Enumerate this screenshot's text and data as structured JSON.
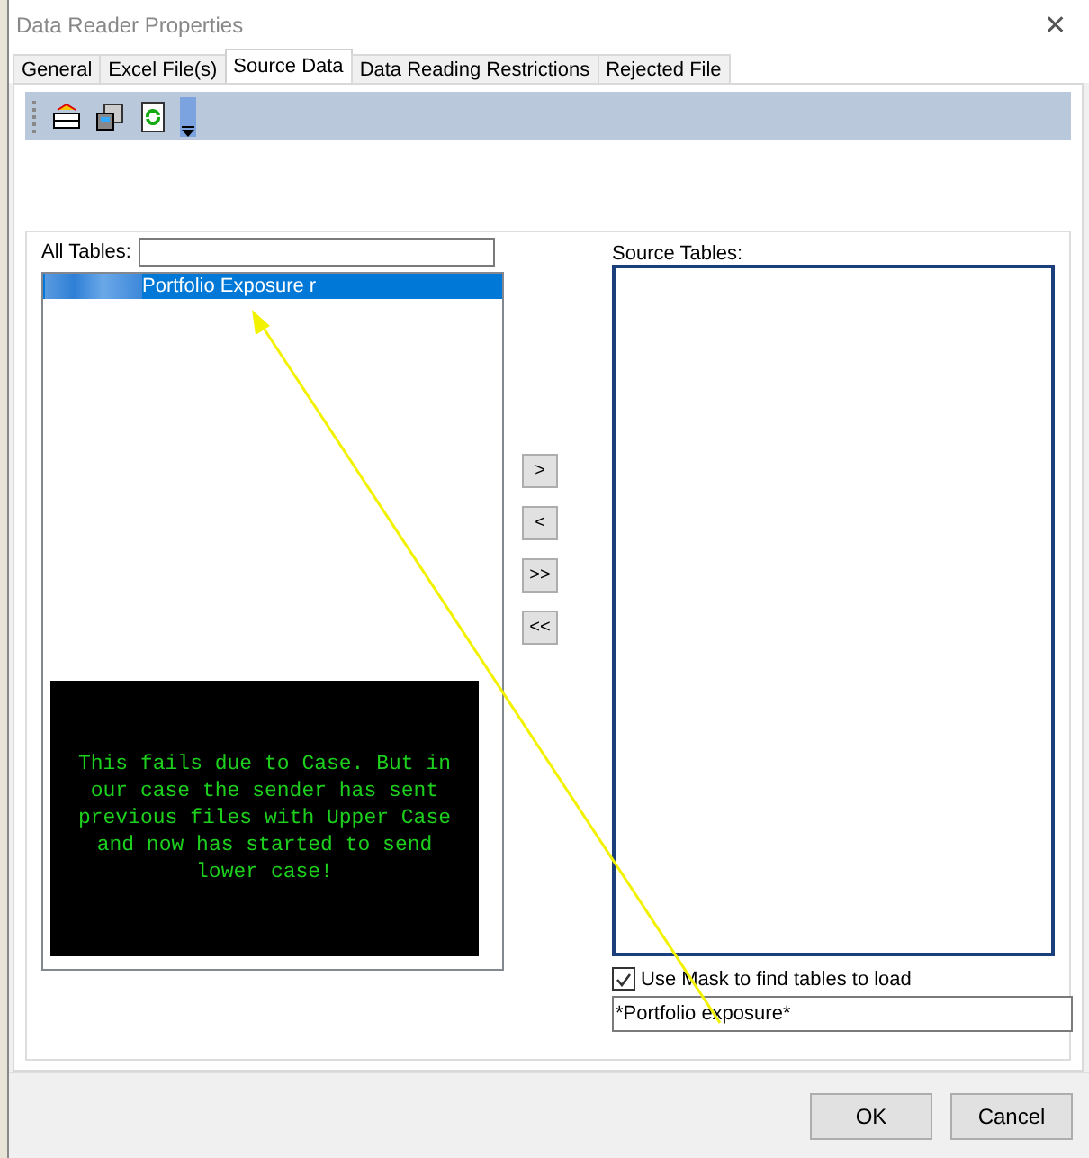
{
  "window": {
    "title": "Data Reader Properties",
    "close": "✕"
  },
  "tabs": [
    {
      "label": "General",
      "selected": false
    },
    {
      "label": "Excel File(s)",
      "selected": false
    },
    {
      "label": "Source Data",
      "selected": true
    },
    {
      "label": "Data Reading Restrictions",
      "selected": false
    },
    {
      "label": "Rejected File",
      "selected": false
    }
  ],
  "all_tables": {
    "label": "All Tables:",
    "items": [
      {
        "text": "Portfolio Exposure r",
        "selected": true
      }
    ]
  },
  "note": "This fails due to Case. But in our case the sender has sent previous files with Upper Case and now has started to send lower case!",
  "move_buttons": [
    ">",
    "<",
    ">>",
    "<<"
  ],
  "source_tables": {
    "label": "Source Tables:"
  },
  "use_mask": {
    "label": "Use Mask to find tables to load",
    "checked": true,
    "value": "*Portfolio exposure*"
  },
  "buttons": [
    "OK",
    "Cancel"
  ]
}
